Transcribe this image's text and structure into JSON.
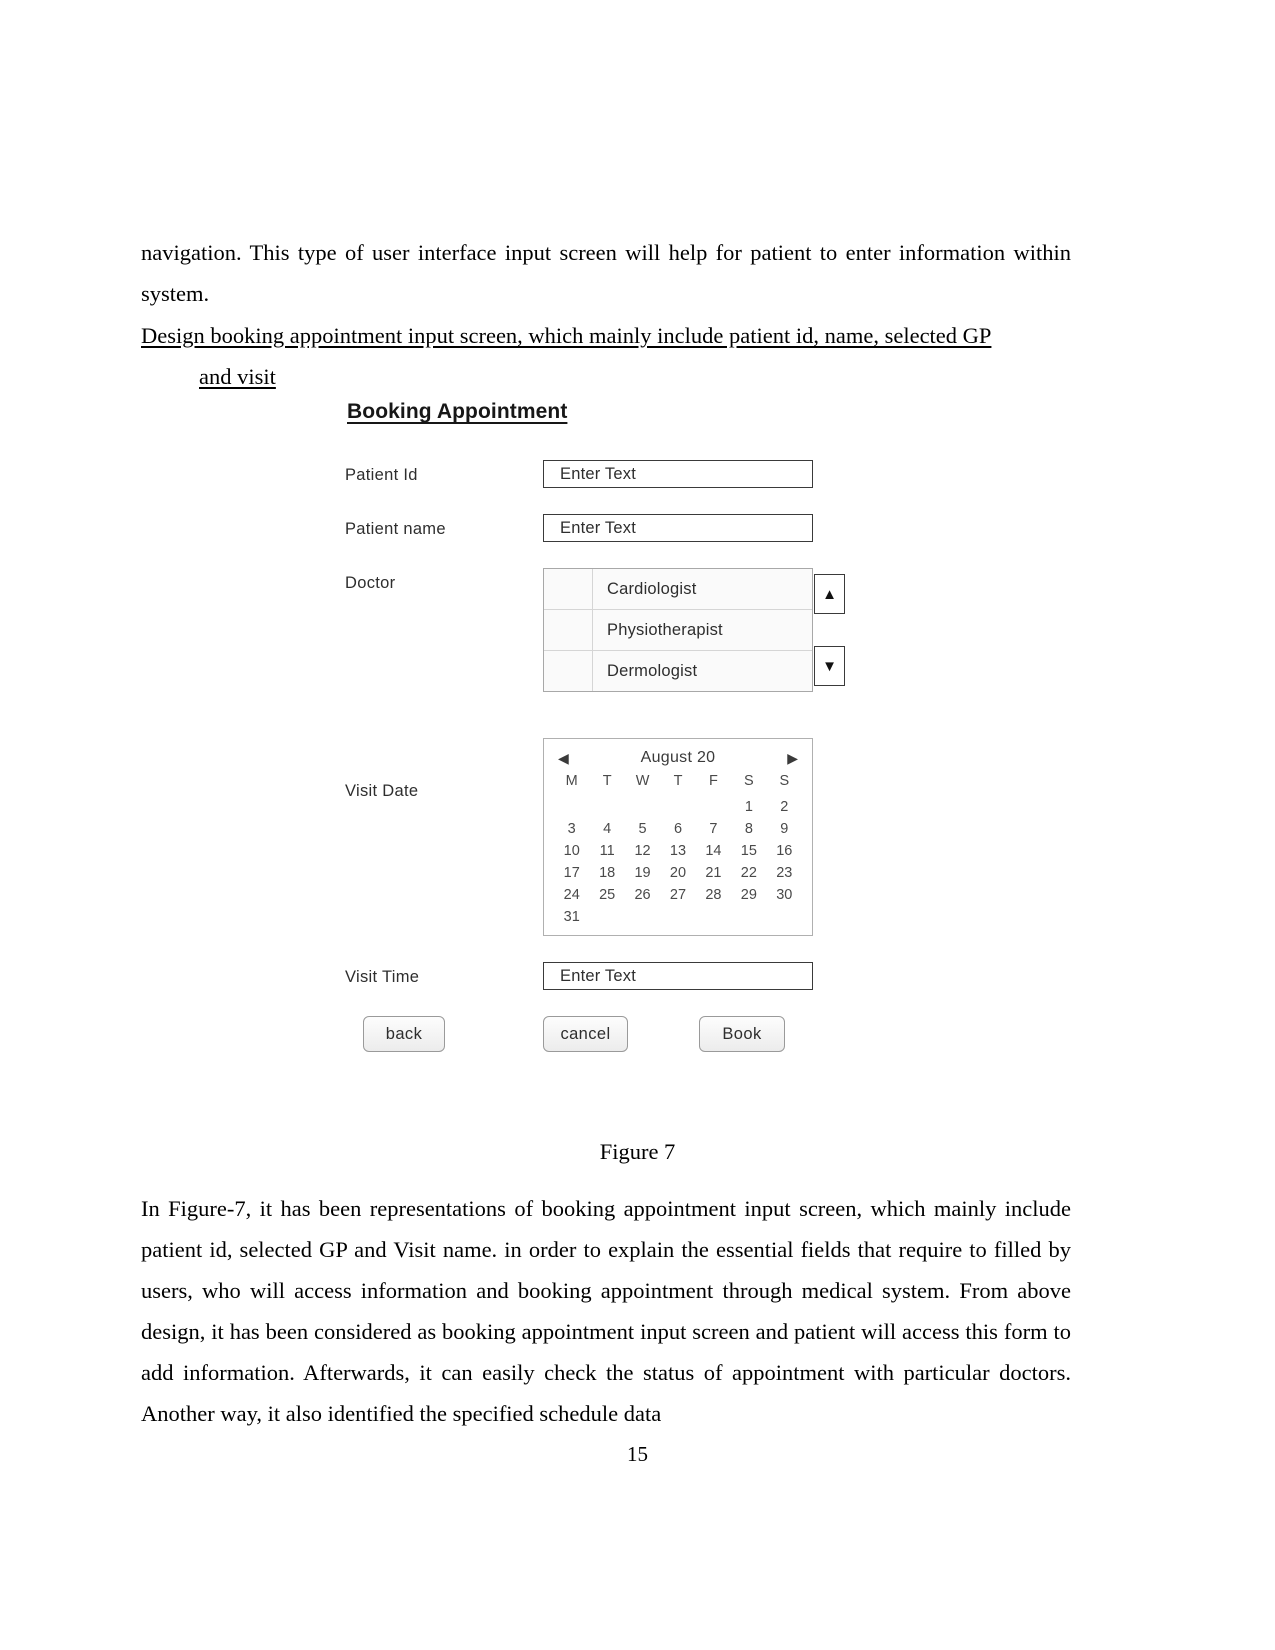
{
  "document": {
    "page_number": "15",
    "paragraph_top": "navigation. This type of user interface input screen will help for patient to enter information within system.",
    "heading_underlined_line1": "Design booking appointment input screen, which mainly include patient id, name, selected GP",
    "heading_underlined_line2": "and visit",
    "figure_caption": "Figure 7",
    "paragraph_bottom": "In Figure-7, it has been representations of booking appointment input screen, which mainly include patient id, selected GP and Visit name. in order to explain the essential fields that require to filled by users, who will access information and booking appointment through medical system. From above design, it has been considered as booking appointment input screen and patient will access this form to add information. Afterwards, it can easily check the status of appointment with particular doctors. Another way, it also identified the specified schedule data"
  },
  "figure": {
    "title": "Booking Appointment",
    "fields": {
      "patient_id": {
        "label": "Patient Id",
        "value": "Enter Text",
        "placeholder": "Enter Text"
      },
      "patient_name": {
        "label": "Patient name",
        "value": "Enter Text",
        "placeholder": "Enter Text"
      },
      "doctor": {
        "label": "Doctor",
        "options": [
          "Cardiologist",
          "Physiotherapist",
          "Dermologist"
        ],
        "scroll_up_icon": "triangle-up",
        "scroll_down_icon": "triangle-down",
        "scroll_up_glyph": "▲",
        "scroll_down_glyph": "▼"
      },
      "visit_date": {
        "label": "Visit Date"
      },
      "visit_time": {
        "label": "Visit Time",
        "value": "Enter Text",
        "placeholder": "Enter Text"
      }
    },
    "calendar": {
      "month_label": "August 20",
      "prev_glyph": "◀",
      "next_glyph": "▶",
      "prev_icon": "chevron-left-icon",
      "next_icon": "chevron-right-icon",
      "day_headers": [
        "M",
        "T",
        "W",
        "T",
        "F",
        "S",
        "S"
      ],
      "leading_blanks": 5,
      "days": [
        1,
        2,
        3,
        4,
        5,
        6,
        7,
        8,
        9,
        10,
        11,
        12,
        13,
        14,
        15,
        16,
        17,
        18,
        19,
        20,
        21,
        22,
        23,
        24,
        25,
        26,
        27,
        28,
        29,
        30,
        31
      ]
    },
    "buttons": {
      "back": "back",
      "cancel": "cancel",
      "book": "Book"
    }
  }
}
